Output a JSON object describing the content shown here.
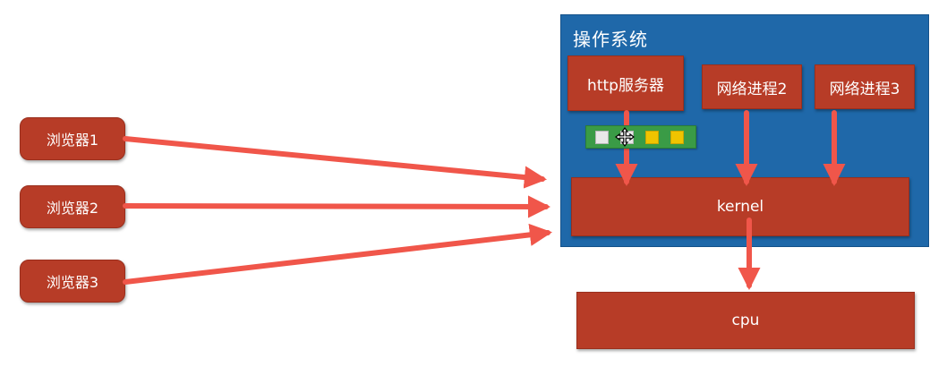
{
  "os": {
    "label": "操作系统"
  },
  "boxes": {
    "http_server": "http服务器",
    "net_proc_2": "网络进程2",
    "net_proc_3": "网络进程3",
    "kernel": "kernel",
    "cpu": "cpu"
  },
  "browsers": [
    "浏览器1",
    "浏览器2",
    "浏览器3"
  ],
  "colors": {
    "os_background": "#1f68a9",
    "box_fill": "#b73c27",
    "arrow": "#f0564a",
    "queue_background": "#3a9b46",
    "queue_item": "#f0c400"
  },
  "icons": {
    "cursor": "move-cursor-icon"
  }
}
